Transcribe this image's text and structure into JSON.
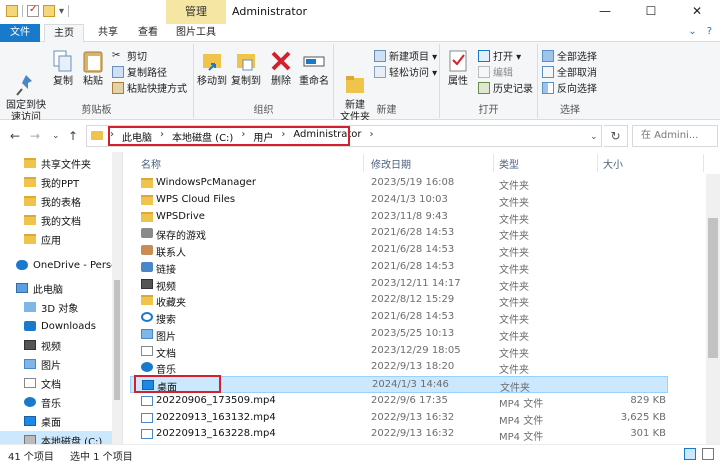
{
  "window": {
    "title": "Administrator",
    "context_tab": "管理",
    "controls": [
      "—",
      "☐",
      "✕"
    ]
  },
  "ribbon_tabs": [
    "文件",
    "主页",
    "共享",
    "查看",
    "图片工具"
  ],
  "ribbon": {
    "clipboard": {
      "label": "剪贴板",
      "pin": "固定到快\n速访问",
      "copy": "复制",
      "paste": "粘贴",
      "cut": "剪切",
      "copy_path": "复制路径",
      "paste_shortcut": "粘贴快捷方式"
    },
    "organize": {
      "label": "组织",
      "move_to": "移动到",
      "copy_to": "复制到",
      "delete": "删除",
      "rename": "重命名"
    },
    "new": {
      "label": "新建",
      "new_folder": "新建\n文件夹",
      "new_item": "新建项目 ▾",
      "easy_access": "轻松访问 ▾"
    },
    "open": {
      "label": "打开",
      "properties": "属性",
      "open": "打开 ▾",
      "edit": "编辑",
      "history": "历史记录"
    },
    "select": {
      "label": "选择",
      "select_all": "全部选择",
      "select_none": "全部取消",
      "invert": "反向选择"
    }
  },
  "address": {
    "crumbs": [
      "此电脑",
      "本地磁盘 (C:)",
      "用户",
      "Administrator"
    ],
    "search_placeholder": "在 Admini..."
  },
  "nav_items": [
    {
      "label": "共享文件夹",
      "icon": "folder"
    },
    {
      "label": "我的PPT",
      "icon": "folder"
    },
    {
      "label": "我的表格",
      "icon": "folder"
    },
    {
      "label": "我的文档",
      "icon": "folder"
    },
    {
      "label": "应用",
      "icon": "folder"
    },
    {
      "label": "OneDrive - Perso",
      "icon": "cloud"
    },
    {
      "label": "此电脑",
      "icon": "pc"
    },
    {
      "label": "3D 对象",
      "icon": "cube"
    },
    {
      "label": "Downloads",
      "icon": "download"
    },
    {
      "label": "视频",
      "icon": "video"
    },
    {
      "label": "图片",
      "icon": "image"
    },
    {
      "label": "文档",
      "icon": "doc"
    },
    {
      "label": "音乐",
      "icon": "music"
    },
    {
      "label": "桌面",
      "icon": "desktop"
    },
    {
      "label": "本地磁盘 (C:)",
      "icon": "drive"
    }
  ],
  "columns": {
    "name": "名称",
    "date": "修改日期",
    "type": "类型",
    "size": "大小"
  },
  "files": [
    {
      "name": "WindowsPcManager",
      "date": "2023/5/19 16:08",
      "type": "文件夹",
      "size": "",
      "icon": "folder"
    },
    {
      "name": "WPS Cloud Files",
      "date": "2024/1/3 10:03",
      "type": "文件夹",
      "size": "",
      "icon": "folder"
    },
    {
      "name": "WPSDrive",
      "date": "2023/11/8 9:43",
      "type": "文件夹",
      "size": "",
      "icon": "folder"
    },
    {
      "name": "保存的游戏",
      "date": "2021/6/28 14:53",
      "type": "文件夹",
      "size": "",
      "icon": "games"
    },
    {
      "name": "联系人",
      "date": "2021/6/28 14:53",
      "type": "文件夹",
      "size": "",
      "icon": "contacts"
    },
    {
      "name": "链接",
      "date": "2021/6/28 14:53",
      "type": "文件夹",
      "size": "",
      "icon": "links"
    },
    {
      "name": "视频",
      "date": "2023/12/11 14:17",
      "type": "文件夹",
      "size": "",
      "icon": "video"
    },
    {
      "name": "收藏夹",
      "date": "2022/8/12 15:29",
      "type": "文件夹",
      "size": "",
      "icon": "favorites"
    },
    {
      "name": "搜索",
      "date": "2021/6/28 14:53",
      "type": "文件夹",
      "size": "",
      "icon": "search"
    },
    {
      "name": "图片",
      "date": "2023/5/25 10:13",
      "type": "文件夹",
      "size": "",
      "icon": "image"
    },
    {
      "name": "文档",
      "date": "2023/12/29 18:05",
      "type": "文件夹",
      "size": "",
      "icon": "doc"
    },
    {
      "name": "音乐",
      "date": "2022/9/13 18:20",
      "type": "文件夹",
      "size": "",
      "icon": "music"
    },
    {
      "name": "桌面",
      "date": "2024/1/3 14:46",
      "type": "文件夹",
      "size": "",
      "icon": "desktop"
    },
    {
      "name": "20220906_173509.mp4",
      "date": "2022/9/6 17:35",
      "type": "MP4 文件",
      "size": "829 KB",
      "icon": "mp4"
    },
    {
      "name": "20220913_163132.mp4",
      "date": "2022/9/13 16:32",
      "type": "MP4 文件",
      "size": "3,625 KB",
      "icon": "mp4"
    },
    {
      "name": "20220913_163228.mp4",
      "date": "2022/9/13 16:32",
      "type": "MP4 文件",
      "size": "301 KB",
      "icon": "mp4"
    }
  ],
  "selected_file": "桌面",
  "status": {
    "count": "41 个项目",
    "selected": "选中 1 个项目"
  },
  "colors": {
    "accent": "#1979ca",
    "selection": "#cce8ff",
    "highlight": "#d3202e",
    "folder": "#f0c34b"
  }
}
